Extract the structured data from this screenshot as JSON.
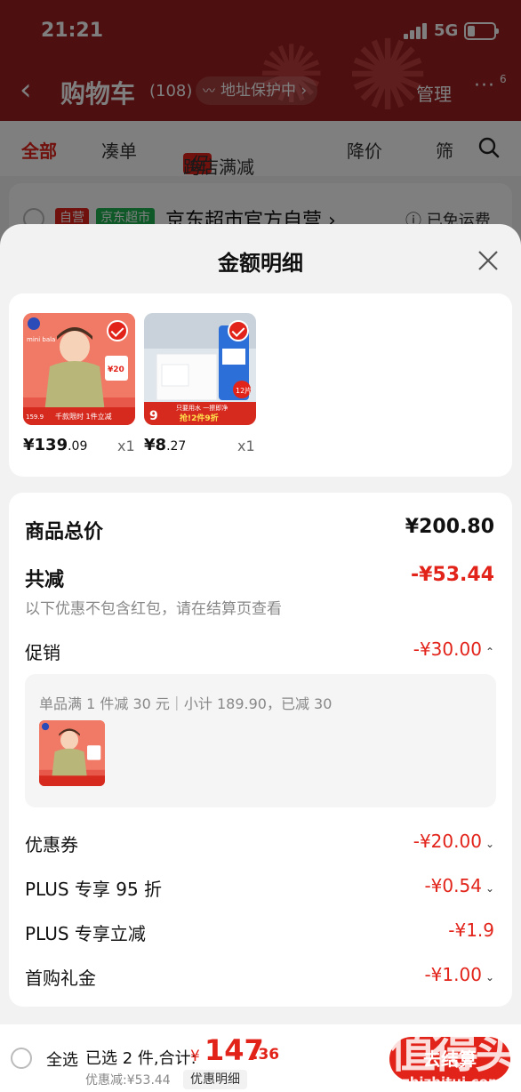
{
  "status_bar": {
    "time": "21:21",
    "network": "5G",
    "battery_level": 0.3
  },
  "nav": {
    "title": "购物车",
    "count": "(108)",
    "address_protect": "地址保护中 ›",
    "manage": "管理",
    "more": "···",
    "more_badge": "6",
    "back": "‹"
  },
  "filters": {
    "all": "全部",
    "combine": "凑单",
    "cu_tag": "促",
    "cross_store": "跨店满减",
    "price_drop": "降价",
    "filter": "筛"
  },
  "store": {
    "tag_self": "自营",
    "tag_super": "京东超市",
    "name": "京东超市官方自营 ›",
    "shipping": "ⓘ 已免运费"
  },
  "sheet": {
    "title": "金额明细",
    "products": [
      {
        "price_int": "¥139",
        "price_dec": ".09",
        "qty": "x1"
      },
      {
        "price_int": "¥8",
        "price_dec": ".27",
        "qty": "x1"
      }
    ],
    "total_label": "商品总价",
    "total_value": "¥200.80",
    "reduce_label": "共减",
    "reduce_value": "-¥53.44",
    "reduce_note": "以下优惠不包含红包，请在结算页查看",
    "promo_label": "促销",
    "promo_value": "-¥30.00",
    "promo_detail": "单品满 1 件减 30 元｜小计 189.90，已减 30",
    "coupon_label": "优惠券",
    "coupon_value": "-¥20.00",
    "plus95_label": "PLUS 专享 95 折",
    "plus95_value": "-¥0.54",
    "plusdirect_label": "PLUS 专享立减",
    "plusdirect_value": "-¥1.9",
    "firstbuy_label": "首购礼金",
    "firstbuy_value": "-¥1.00",
    "chevron_down": "⌄",
    "chevron_up": "⌃"
  },
  "product_images": [
    {
      "brand": "mini bala",
      "banner": "千款限时 1件立减",
      "corner_price": "159.9",
      "badge": "¥20"
    },
    {
      "banner": "只要用水 一擦即净",
      "sub_banner": "抢!2件9折",
      "corner_num": "9",
      "count_badge": "12片"
    }
  ],
  "bottom": {
    "select_all": "全选",
    "selected": "已选 2 件,合计:",
    "currency": "¥",
    "total_int": "147",
    "total_dec": ".36",
    "discount": "优惠减:¥53.44",
    "detail": "优惠明细",
    "checkout": "去结算"
  },
  "watermark": {
    "big": "值得买",
    "small": "zhizhitui.com"
  },
  "colors": {
    "accent": "#e2231a",
    "header_bg": "#9b1e1e",
    "green_tag": "#1db34f"
  }
}
